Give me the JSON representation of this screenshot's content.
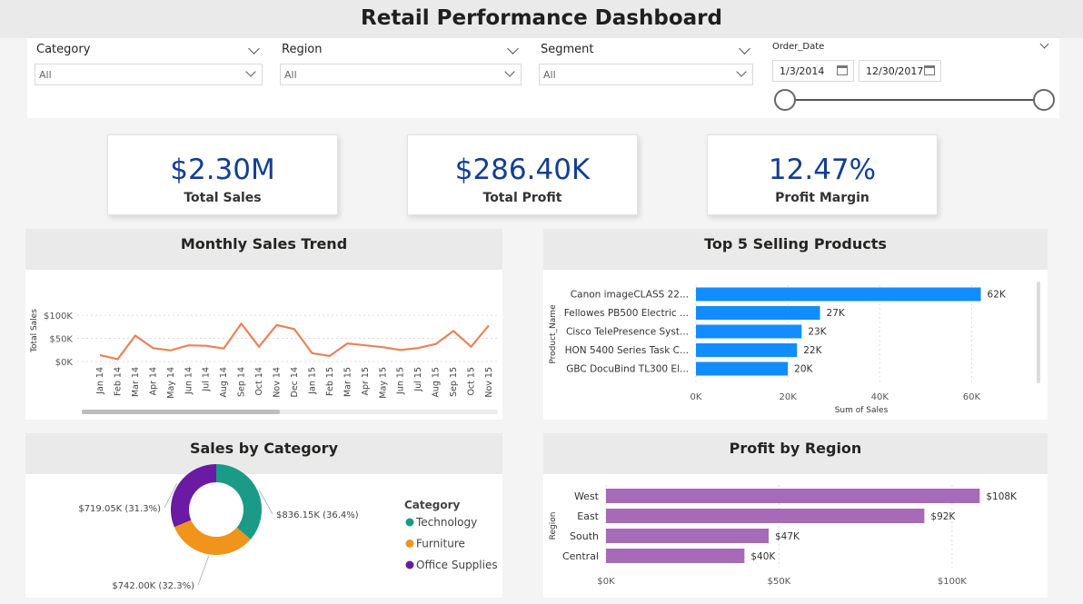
{
  "title": "Retail Performance Dashboard",
  "filters": {
    "category": {
      "label": "Category",
      "value": "All"
    },
    "region": {
      "label": "Region",
      "value": "All"
    },
    "segment": {
      "label": "Segment",
      "value": "All"
    },
    "order_date": {
      "label": "Order_Date",
      "start": "1/3/2014",
      "end": "12/30/2017"
    }
  },
  "kpis": [
    {
      "value": "$2.30M",
      "label": "Total Sales"
    },
    {
      "value": "$286.40K",
      "label": "Total Profit"
    },
    {
      "value": "12.47%",
      "label": "Profit Margin"
    }
  ],
  "colors": {
    "line": "#e8825a",
    "bar_blue": "#118dff",
    "bar_purple": "#a66ab7",
    "technology": "#1a9a87",
    "furniture": "#f0941c",
    "office_supplies": "#6a1aa3",
    "kpi_value": "#123f8f"
  },
  "chart_data": [
    {
      "id": "monthly",
      "title": "Monthly Sales Trend",
      "type": "line",
      "ylabel": "Total Sales",
      "xlabel": "",
      "y_ticks": [
        "$0K",
        "$50K",
        "$100K"
      ],
      "ylim": [
        0,
        110
      ],
      "unit": "K$",
      "categories": [
        "Jan 14",
        "Feb 14",
        "Mar 14",
        "Apr 14",
        "May 14",
        "Jun 14",
        "Jul 14",
        "Aug 14",
        "Sep 14",
        "Oct 14",
        "Nov 14",
        "Dec 14",
        "Jan 15",
        "Feb 15",
        "Mar 15",
        "Apr 15",
        "May 15",
        "Jun 15",
        "Jul 15",
        "Aug 15",
        "Sep 15",
        "Oct 15",
        "Nov 15"
      ],
      "values": [
        14,
        5,
        56,
        29,
        24,
        35,
        34,
        28,
        82,
        32,
        79,
        70,
        18,
        12,
        39,
        35,
        31,
        25,
        29,
        38,
        66,
        32,
        78
      ]
    },
    {
      "id": "top5",
      "title": "Top 5 Selling Products",
      "type": "bar",
      "orientation": "horizontal",
      "ylabel": "Product_Name",
      "xlabel": "Sum of Sales",
      "x_ticks": [
        "0K",
        "20K",
        "40K",
        "60K"
      ],
      "xlim": [
        0,
        70
      ],
      "categories": [
        "Canon imageCLASS 22...",
        "Fellowes PB500 Electric ...",
        "Cisco TelePresence Syst...",
        "HON 5400 Series Task C...",
        "GBC DocuBind TL300 El..."
      ],
      "values": [
        62,
        27,
        23,
        22,
        20
      ],
      "data_labels": [
        "62K",
        "27K",
        "23K",
        "22K",
        "20K"
      ]
    },
    {
      "id": "category",
      "title": "Sales by Category",
      "type": "pie",
      "legend_title": "Category",
      "categories": [
        "Technology",
        "Furniture",
        "Office Supplies"
      ],
      "values": [
        836.15,
        742.0,
        719.05
      ],
      "data_labels": [
        "$836.15K (36.4%)",
        "$742.00K (32.3%)",
        "$719.05K (31.3%)"
      ]
    },
    {
      "id": "region",
      "title": "Profit by Region",
      "type": "bar",
      "orientation": "horizontal",
      "ylabel": "Region",
      "xlabel": "",
      "x_ticks": [
        "$0K",
        "$50K",
        "$100K"
      ],
      "xlim": [
        0,
        115
      ],
      "categories": [
        "West",
        "East",
        "South",
        "Central"
      ],
      "values": [
        108,
        92,
        47,
        40
      ],
      "data_labels": [
        "$108K",
        "$92K",
        "$47K",
        "$40K"
      ]
    }
  ]
}
